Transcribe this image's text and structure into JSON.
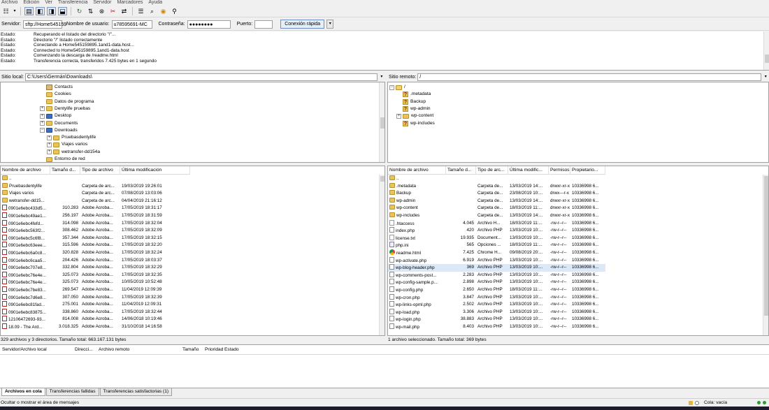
{
  "menu": [
    "Archivo",
    "Edición",
    "Ver",
    "Transferencia",
    "Servidor",
    "Marcadores",
    "Ayuda"
  ],
  "toolbar_icons": [
    "site-manager-icon",
    "dropdown-arrow-icon",
    "toggle-log-icon",
    "toggle-local-tree-icon",
    "toggle-remote-tree-icon",
    "toggle-queue-icon",
    "refresh-icon",
    "process-queue-icon",
    "cancel-icon",
    "disconnect-icon",
    "reconnect-icon",
    "filter-icon",
    "compare-icon",
    "sync-browse-icon",
    "search-icon"
  ],
  "quickconnect": {
    "server_label": "Servidor:",
    "server_value": "sftp://Home545159",
    "user_label": "Nombre de usuario:",
    "user_value": "u78595691-MC",
    "password_label": "Contraseña:",
    "password_value": "●●●●●●●●",
    "port_label": "Puerto:",
    "port_value": "",
    "connect_label": "Conexión rápida"
  },
  "log": [
    {
      "k": "Estado:",
      "v": "Recuperando el listado del directorio \"/\"..."
    },
    {
      "k": "Estado:",
      "v": "Directorio \"/\" listado correctamente"
    },
    {
      "k": "Estado:",
      "v": "Conectando a Home545159895.1and1-data.host..."
    },
    {
      "k": "Estado:",
      "v": "Connected to Home545159895.1and1-data.host"
    },
    {
      "k": "Estado:",
      "v": "Comenzando la descarga de /readme.html"
    },
    {
      "k": "Estado:",
      "v": "Transferencia correcta, transferidos 7.425 bytes en 1 segundo"
    }
  ],
  "local": {
    "site_label": "Sitio local:",
    "path": "C:\\Users\\Germán\\Downloads\\",
    "tree": [
      {
        "label": "Contacts",
        "exp": "",
        "icon": "contact"
      },
      {
        "label": "Cookies",
        "exp": "",
        "icon": "folder"
      },
      {
        "label": "Datos de programa",
        "exp": "",
        "icon": "folder"
      },
      {
        "label": "Dentylife pruebas",
        "exp": "+",
        "icon": "folder"
      },
      {
        "label": "Desktop",
        "exp": "+",
        "icon": "blue"
      },
      {
        "label": "Documents",
        "exp": "+",
        "icon": "folder"
      },
      {
        "label": "Downloads",
        "exp": "−",
        "icon": "blue"
      },
      {
        "label": "Pruebasdentylife",
        "exp": "+",
        "icon": "folder"
      },
      {
        "label": "Viajes varios",
        "exp": "+",
        "icon": "folder"
      },
      {
        "label": "wetransfer-dd154a",
        "exp": "+",
        "icon": "folder"
      },
      {
        "label": "Entorno de red",
        "exp": "",
        "icon": "folder"
      }
    ],
    "columns": [
      "Nombre de archivo",
      "Tamaño d...",
      "Tipo de archivo",
      "Última modificación"
    ],
    "rows": [
      {
        "name": "..",
        "size": "",
        "type": "",
        "date": "",
        "icon": "folder"
      },
      {
        "name": "Pruebasdentylife",
        "size": "",
        "type": "Carpeta de arc...",
        "date": "19/03/2019 19:26:01",
        "icon": "folder"
      },
      {
        "name": "Viajes varios",
        "size": "",
        "type": "Carpeta de arc...",
        "date": "07/08/2019 13:03:06",
        "icon": "folder"
      },
      {
        "name": "wetransfer-dd15...",
        "size": "",
        "type": "Carpeta de arc...",
        "date": "04/04/2019 21:16:12",
        "icon": "folder"
      },
      {
        "name": "0901e6ebc433d5...",
        "size": "310.283",
        "type": "Adobe Acroba...",
        "date": "17/05/2019 18:31:17",
        "icon": "pdf"
      },
      {
        "name": "0901e6ebc49ae1...",
        "size": "256.197",
        "type": "Adobe Acroba...",
        "date": "17/05/2019 18:31:59",
        "icon": "pdf"
      },
      {
        "name": "0901e6ebc4fefd...",
        "size": "314.098",
        "type": "Adobe Acroba...",
        "date": "17/05/2019 18:32:04",
        "icon": "pdf"
      },
      {
        "name": "0901e6ebc563f2...",
        "size": "308.462",
        "type": "Adobe Acroba...",
        "date": "17/05/2019 18:32:09",
        "icon": "pdf"
      },
      {
        "name": "0901e6ebc5c6f8...",
        "size": "357.344",
        "type": "Adobe Acroba...",
        "date": "17/05/2019 18:32:15",
        "icon": "pdf"
      },
      {
        "name": "0901e6ebc63eee...",
        "size": "315.596",
        "type": "Adobe Acroba...",
        "date": "17/05/2019 18:32:20",
        "icon": "pdf"
      },
      {
        "name": "0901e6ebc6a0c8...",
        "size": "320.828",
        "type": "Adobe Acroba...",
        "date": "17/05/2019 18:32:24",
        "icon": "pdf"
      },
      {
        "name": "0901e6ebc6caa5...",
        "size": "204.426",
        "type": "Adobe Acroba...",
        "date": "17/05/2019 18:03:37",
        "icon": "pdf"
      },
      {
        "name": "0901e6ebc707e8...",
        "size": "332.804",
        "type": "Adobe Acroba...",
        "date": "17/05/2019 18:32:29",
        "icon": "pdf"
      },
      {
        "name": "0901e6ebc76e4e...",
        "size": "325.073",
        "type": "Adobe Acroba...",
        "date": "17/05/2019 18:32:35",
        "icon": "pdf"
      },
      {
        "name": "0901e6ebc76e4e...",
        "size": "325.073",
        "type": "Adobe Acroba...",
        "date": "10/05/2019 10:52:48",
        "icon": "pdf"
      },
      {
        "name": "0901e6ebc7be83...",
        "size": "269.547",
        "type": "Adobe Acroba...",
        "date": "11/04/2019 12:09:39",
        "icon": "pdf"
      },
      {
        "name": "0901e6ebc7d6e8...",
        "size": "307.050",
        "type": "Adobe Acroba...",
        "date": "17/05/2019 18:32:39",
        "icon": "pdf"
      },
      {
        "name": "0901e6ebc81fad...",
        "size": "275.001",
        "type": "Adobe Acroba...",
        "date": "11/04/2019 12:09:31",
        "icon": "pdf"
      },
      {
        "name": "0901e6ebc83875...",
        "size": "338.860",
        "type": "Adobe Acroba...",
        "date": "17/05/2019 18:32:44",
        "icon": "pdf"
      },
      {
        "name": "12106472693-93...",
        "size": "814.008",
        "type": "Adobe Acroba...",
        "date": "14/06/2018 10:19:46",
        "icon": "pdf"
      },
      {
        "name": "18.09 - The Ard...",
        "size": "3.018.325",
        "type": "Adobe Acroba...",
        "date": "31/10/2018 14:16:58",
        "icon": "pdf"
      }
    ],
    "status": "329 archivos y 3 directorios. Tamaño total: 663.167.131 bytes"
  },
  "remote": {
    "site_label": "Sitio remoto:",
    "path": "/",
    "tree": [
      {
        "label": "/",
        "exp": "−",
        "icon": "open"
      },
      {
        "label": ".metadata",
        "exp": "",
        "icon": "q"
      },
      {
        "label": "Backup",
        "exp": "",
        "icon": "q"
      },
      {
        "label": "wp-admin",
        "exp": "",
        "icon": "q"
      },
      {
        "label": "wp-content",
        "exp": "+",
        "icon": "folder"
      },
      {
        "label": "wp-includes",
        "exp": "",
        "icon": "q"
      }
    ],
    "columns": [
      "Nombre de archivo",
      "Tamaño d...",
      "Tipo de arc...",
      "Última modific...",
      "Permisos",
      "Propietario..."
    ],
    "rows": [
      {
        "name": "..",
        "size": "",
        "type": "",
        "date": "",
        "perm": "",
        "owner": "",
        "icon": "folder"
      },
      {
        "name": ".metadata",
        "size": "",
        "type": "Carpeta de...",
        "date": "13/03/2019 14:...",
        "perm": "drwxr-xr-x",
        "owner": "10336998 6...",
        "icon": "folder"
      },
      {
        "name": "Backup",
        "size": "",
        "type": "Carpeta de...",
        "date": "23/08/2019 10:...",
        "perm": "drwx---r-x",
        "owner": "10336998 6...",
        "icon": "folder"
      },
      {
        "name": "wp-admin",
        "size": "",
        "type": "Carpeta de...",
        "date": "13/03/2019 14:...",
        "perm": "drwxr-xr-x",
        "owner": "10336998 6...",
        "icon": "folder"
      },
      {
        "name": "wp-content",
        "size": "",
        "type": "Carpeta de...",
        "date": "18/03/2019 11:...",
        "perm": "drwxr-xr-x",
        "owner": "10336998 6...",
        "icon": "folder"
      },
      {
        "name": "wp-includes",
        "size": "",
        "type": "Carpeta de...",
        "date": "13/03/2019 14:...",
        "perm": "drwxr-xr-x",
        "owner": "10336998 6...",
        "icon": "folder"
      },
      {
        "name": ".htaccess",
        "size": "4.045",
        "type": "Archivo H...",
        "date": "18/03/2019 11:...",
        "perm": "-rw-r--r--",
        "owner": "10336998 6...",
        "icon": "file"
      },
      {
        "name": "index.php",
        "size": "420",
        "type": "Archivo PHP",
        "date": "13/03/2019 10:...",
        "perm": "-rw-r--r--",
        "owner": "10336998 6...",
        "icon": "php"
      },
      {
        "name": "license.txt",
        "size": "19.935",
        "type": "Document...",
        "date": "13/03/2019 10:...",
        "perm": "-rw-r--r--",
        "owner": "10336998 6...",
        "icon": "file"
      },
      {
        "name": "php.ini",
        "size": "565",
        "type": "Opciones ...",
        "date": "18/03/2019 11:...",
        "perm": "-rw-r--r--",
        "owner": "10336998 6...",
        "icon": "ini"
      },
      {
        "name": "readme.html",
        "size": "7.425",
        "type": "Chrome H...",
        "date": "09/08/2019 20:...",
        "perm": "-rw-r--r--",
        "owner": "10336998 6...",
        "icon": "chrome"
      },
      {
        "name": "wp-activate.php",
        "size": "6.919",
        "type": "Archivo PHP",
        "date": "13/03/2019 10:...",
        "perm": "-rw-r--r--",
        "owner": "10336998 6...",
        "icon": "php"
      },
      {
        "name": "wp-blog-header.php",
        "size": "369",
        "type": "Archivo PHP",
        "date": "13/03/2019 10:...",
        "perm": "-rw-r--r--",
        "owner": "10336998 6...",
        "icon": "php",
        "selected": true
      },
      {
        "name": "wp-comments-post...",
        "size": "2.283",
        "type": "Archivo PHP",
        "date": "13/03/2019 10:...",
        "perm": "-rw-r--r--",
        "owner": "10336998 6...",
        "icon": "php"
      },
      {
        "name": "wp-config-sample.p...",
        "size": "2.898",
        "type": "Archivo PHP",
        "date": "13/03/2019 10:...",
        "perm": "-rw-r--r--",
        "owner": "10336998 6...",
        "icon": "php"
      },
      {
        "name": "wp-config.php",
        "size": "2.650",
        "type": "Archivo PHP",
        "date": "18/03/2019 11:...",
        "perm": "-rw-r--r--",
        "owner": "10336998 6...",
        "icon": "php"
      },
      {
        "name": "wp-cron.php",
        "size": "3.847",
        "type": "Archivo PHP",
        "date": "13/03/2019 10:...",
        "perm": "-rw-r--r--",
        "owner": "10336998 6...",
        "icon": "php"
      },
      {
        "name": "wp-links-opml.php",
        "size": "2.502",
        "type": "Archivo PHP",
        "date": "13/03/2019 10:...",
        "perm": "-rw-r--r--",
        "owner": "10336998 6...",
        "icon": "php"
      },
      {
        "name": "wp-load.php",
        "size": "3.306",
        "type": "Archivo PHP",
        "date": "13/03/2019 10:...",
        "perm": "-rw-r--r--",
        "owner": "10336998 6...",
        "icon": "php"
      },
      {
        "name": "wp-login.php",
        "size": "38.883",
        "type": "Archivo PHP",
        "date": "13/03/2019 10:...",
        "perm": "-rw-r--r--",
        "owner": "10336998 6...",
        "icon": "php"
      },
      {
        "name": "wp-mail.php",
        "size": "8.403",
        "type": "Archivo PHP",
        "date": "13/03/2019 10:...",
        "perm": "-rw-r--r--",
        "owner": "10336998 6...",
        "icon": "php"
      }
    ],
    "status": "1 archivo seleccionado. Tamaño total: 369 bytes"
  },
  "queue": {
    "columns": [
      "Servidor/Archivo local",
      "Direcci...",
      "Archivo remoto",
      "Tamaño",
      "Prioridad",
      "Estado"
    ]
  },
  "tabs": [
    "Archivos en cola",
    "Transferencias fallidas",
    "Transferencias satisfactorias (1)"
  ],
  "statusbar": {
    "left": "Ocultar o mostrar el área de mensajes",
    "queue": "Cola: vacía"
  }
}
